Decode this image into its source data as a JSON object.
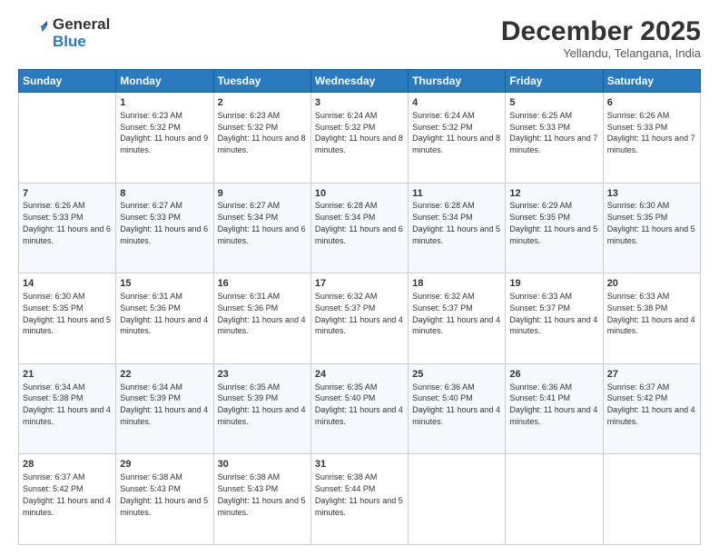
{
  "header": {
    "logo_general": "General",
    "logo_blue": "Blue",
    "title": "December 2025",
    "subtitle": "Yellandu, Telangana, India"
  },
  "days_of_week": [
    "Sunday",
    "Monday",
    "Tuesday",
    "Wednesday",
    "Thursday",
    "Friday",
    "Saturday"
  ],
  "weeks": [
    [
      {
        "day": "",
        "sunrise": "",
        "sunset": "",
        "daylight": ""
      },
      {
        "day": "1",
        "sunrise": "Sunrise: 6:23 AM",
        "sunset": "Sunset: 5:32 PM",
        "daylight": "Daylight: 11 hours and 9 minutes."
      },
      {
        "day": "2",
        "sunrise": "Sunrise: 6:23 AM",
        "sunset": "Sunset: 5:32 PM",
        "daylight": "Daylight: 11 hours and 8 minutes."
      },
      {
        "day": "3",
        "sunrise": "Sunrise: 6:24 AM",
        "sunset": "Sunset: 5:32 PM",
        "daylight": "Daylight: 11 hours and 8 minutes."
      },
      {
        "day": "4",
        "sunrise": "Sunrise: 6:24 AM",
        "sunset": "Sunset: 5:32 PM",
        "daylight": "Daylight: 11 hours and 8 minutes."
      },
      {
        "day": "5",
        "sunrise": "Sunrise: 6:25 AM",
        "sunset": "Sunset: 5:33 PM",
        "daylight": "Daylight: 11 hours and 7 minutes."
      },
      {
        "day": "6",
        "sunrise": "Sunrise: 6:26 AM",
        "sunset": "Sunset: 5:33 PM",
        "daylight": "Daylight: 11 hours and 7 minutes."
      }
    ],
    [
      {
        "day": "7",
        "sunrise": "Sunrise: 6:26 AM",
        "sunset": "Sunset: 5:33 PM",
        "daylight": "Daylight: 11 hours and 6 minutes."
      },
      {
        "day": "8",
        "sunrise": "Sunrise: 6:27 AM",
        "sunset": "Sunset: 5:33 PM",
        "daylight": "Daylight: 11 hours and 6 minutes."
      },
      {
        "day": "9",
        "sunrise": "Sunrise: 6:27 AM",
        "sunset": "Sunset: 5:34 PM",
        "daylight": "Daylight: 11 hours and 6 minutes."
      },
      {
        "day": "10",
        "sunrise": "Sunrise: 6:28 AM",
        "sunset": "Sunset: 5:34 PM",
        "daylight": "Daylight: 11 hours and 6 minutes."
      },
      {
        "day": "11",
        "sunrise": "Sunrise: 6:28 AM",
        "sunset": "Sunset: 5:34 PM",
        "daylight": "Daylight: 11 hours and 5 minutes."
      },
      {
        "day": "12",
        "sunrise": "Sunrise: 6:29 AM",
        "sunset": "Sunset: 5:35 PM",
        "daylight": "Daylight: 11 hours and 5 minutes."
      },
      {
        "day": "13",
        "sunrise": "Sunrise: 6:30 AM",
        "sunset": "Sunset: 5:35 PM",
        "daylight": "Daylight: 11 hours and 5 minutes."
      }
    ],
    [
      {
        "day": "14",
        "sunrise": "Sunrise: 6:30 AM",
        "sunset": "Sunset: 5:35 PM",
        "daylight": "Daylight: 11 hours and 5 minutes."
      },
      {
        "day": "15",
        "sunrise": "Sunrise: 6:31 AM",
        "sunset": "Sunset: 5:36 PM",
        "daylight": "Daylight: 11 hours and 4 minutes."
      },
      {
        "day": "16",
        "sunrise": "Sunrise: 6:31 AM",
        "sunset": "Sunset: 5:36 PM",
        "daylight": "Daylight: 11 hours and 4 minutes."
      },
      {
        "day": "17",
        "sunrise": "Sunrise: 6:32 AM",
        "sunset": "Sunset: 5:37 PM",
        "daylight": "Daylight: 11 hours and 4 minutes."
      },
      {
        "day": "18",
        "sunrise": "Sunrise: 6:32 AM",
        "sunset": "Sunset: 5:37 PM",
        "daylight": "Daylight: 11 hours and 4 minutes."
      },
      {
        "day": "19",
        "sunrise": "Sunrise: 6:33 AM",
        "sunset": "Sunset: 5:37 PM",
        "daylight": "Daylight: 11 hours and 4 minutes."
      },
      {
        "day": "20",
        "sunrise": "Sunrise: 6:33 AM",
        "sunset": "Sunset: 5:38 PM",
        "daylight": "Daylight: 11 hours and 4 minutes."
      }
    ],
    [
      {
        "day": "21",
        "sunrise": "Sunrise: 6:34 AM",
        "sunset": "Sunset: 5:38 PM",
        "daylight": "Daylight: 11 hours and 4 minutes."
      },
      {
        "day": "22",
        "sunrise": "Sunrise: 6:34 AM",
        "sunset": "Sunset: 5:39 PM",
        "daylight": "Daylight: 11 hours and 4 minutes."
      },
      {
        "day": "23",
        "sunrise": "Sunrise: 6:35 AM",
        "sunset": "Sunset: 5:39 PM",
        "daylight": "Daylight: 11 hours and 4 minutes."
      },
      {
        "day": "24",
        "sunrise": "Sunrise: 6:35 AM",
        "sunset": "Sunset: 5:40 PM",
        "daylight": "Daylight: 11 hours and 4 minutes."
      },
      {
        "day": "25",
        "sunrise": "Sunrise: 6:36 AM",
        "sunset": "Sunset: 5:40 PM",
        "daylight": "Daylight: 11 hours and 4 minutes."
      },
      {
        "day": "26",
        "sunrise": "Sunrise: 6:36 AM",
        "sunset": "Sunset: 5:41 PM",
        "daylight": "Daylight: 11 hours and 4 minutes."
      },
      {
        "day": "27",
        "sunrise": "Sunrise: 6:37 AM",
        "sunset": "Sunset: 5:42 PM",
        "daylight": "Daylight: 11 hours and 4 minutes."
      }
    ],
    [
      {
        "day": "28",
        "sunrise": "Sunrise: 6:37 AM",
        "sunset": "Sunset: 5:42 PM",
        "daylight": "Daylight: 11 hours and 4 minutes."
      },
      {
        "day": "29",
        "sunrise": "Sunrise: 6:38 AM",
        "sunset": "Sunset: 5:43 PM",
        "daylight": "Daylight: 11 hours and 5 minutes."
      },
      {
        "day": "30",
        "sunrise": "Sunrise: 6:38 AM",
        "sunset": "Sunset: 5:43 PM",
        "daylight": "Daylight: 11 hours and 5 minutes."
      },
      {
        "day": "31",
        "sunrise": "Sunrise: 6:38 AM",
        "sunset": "Sunset: 5:44 PM",
        "daylight": "Daylight: 11 hours and 5 minutes."
      },
      {
        "day": "",
        "sunrise": "",
        "sunset": "",
        "daylight": ""
      },
      {
        "day": "",
        "sunrise": "",
        "sunset": "",
        "daylight": ""
      },
      {
        "day": "",
        "sunrise": "",
        "sunset": "",
        "daylight": ""
      }
    ]
  ]
}
